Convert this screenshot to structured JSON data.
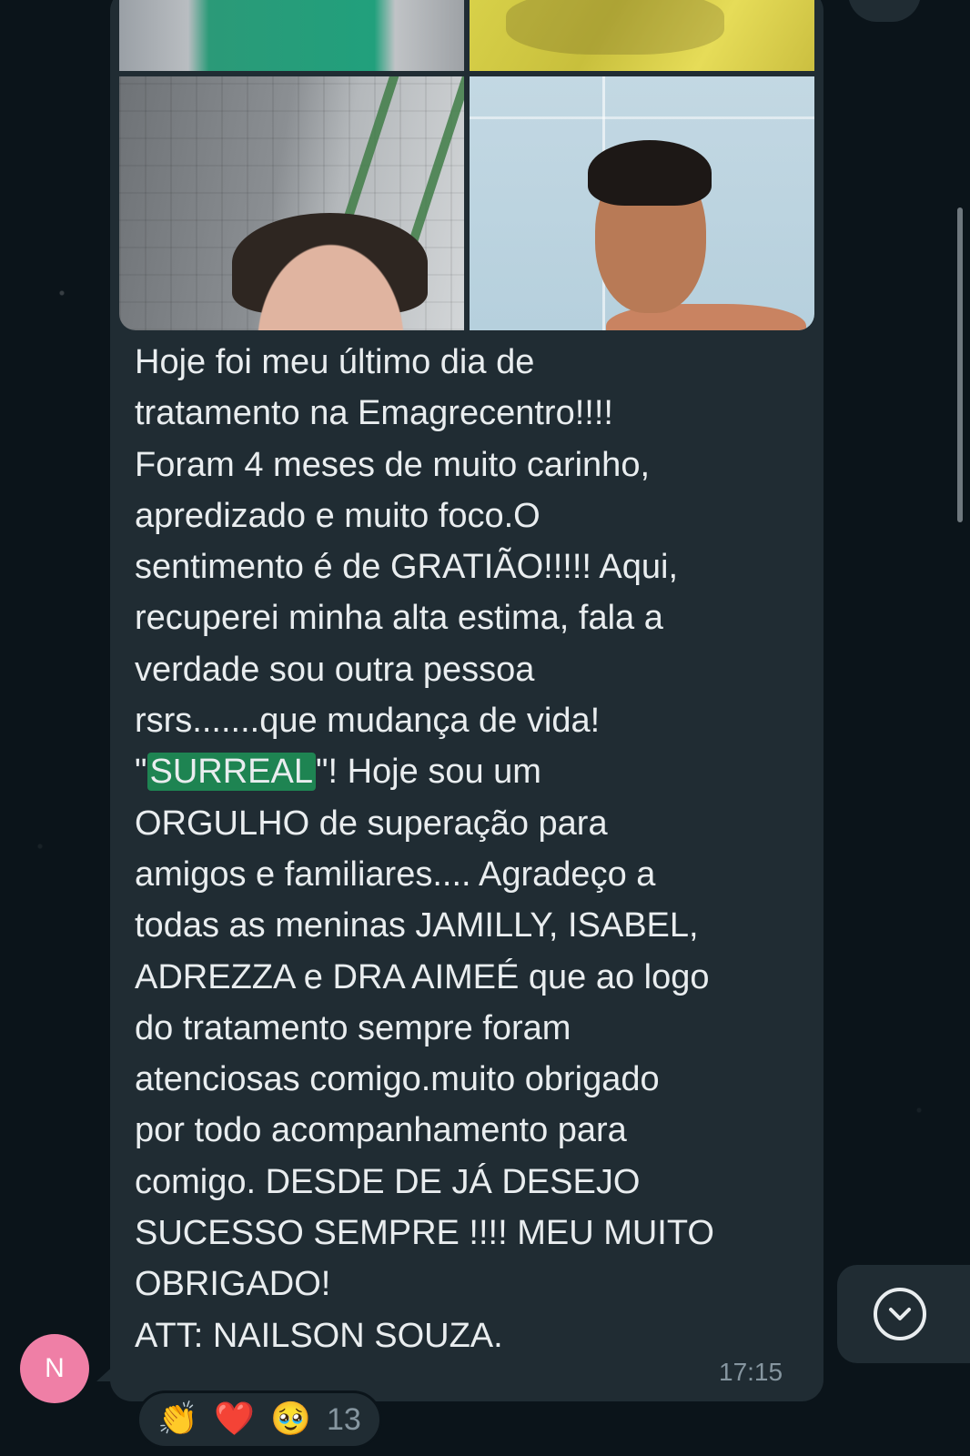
{
  "message": {
    "text_before_highlight": "Hoje foi meu último dia de\ntratamento na Emagrecentro!!!!\nForam 4 meses de muito carinho,\napredizado e muito foco.O\nsentimento é de GRATIÃO!!!!! Aqui,\nrecuperei minha alta estima, fala a\nverdade sou outra pessoa\nrsrs.......que mudança de vida!\n\"",
    "highlight": "SURREAL",
    "text_after_highlight": "\"! Hoje sou  um\nORGULHO  de superação para\namigos e familiares.... Agradeço a\ntodas as meninas JAMILLY, ISABEL,\nADREZZA e  DRA AIMEÉ que ao logo\ndo tratamento sempre foram\natenciosas  comigo.muito obrigado\npor todo acompanhamento para\ncomigo. DESDE DE JÁ  DESEJO\nSUCESSO SEMPRE !!!! MEU MUITO\nOBRIGADO!\nATT: NAILSON SOUZA.",
    "timestamp": "17:15"
  },
  "sender": {
    "avatar_initial": "N",
    "avatar_color": "#ef7fa6"
  },
  "reactions": {
    "emojis": [
      "👏",
      "❤️",
      "🥹"
    ],
    "count": "13"
  },
  "icons": {
    "scroll_down": "chevron-down-circle-icon"
  },
  "colors": {
    "background": "#0b141a",
    "bubble": "#202c33",
    "highlight": "#1e8452",
    "text": "#e9edef",
    "meta": "#8696a0"
  }
}
